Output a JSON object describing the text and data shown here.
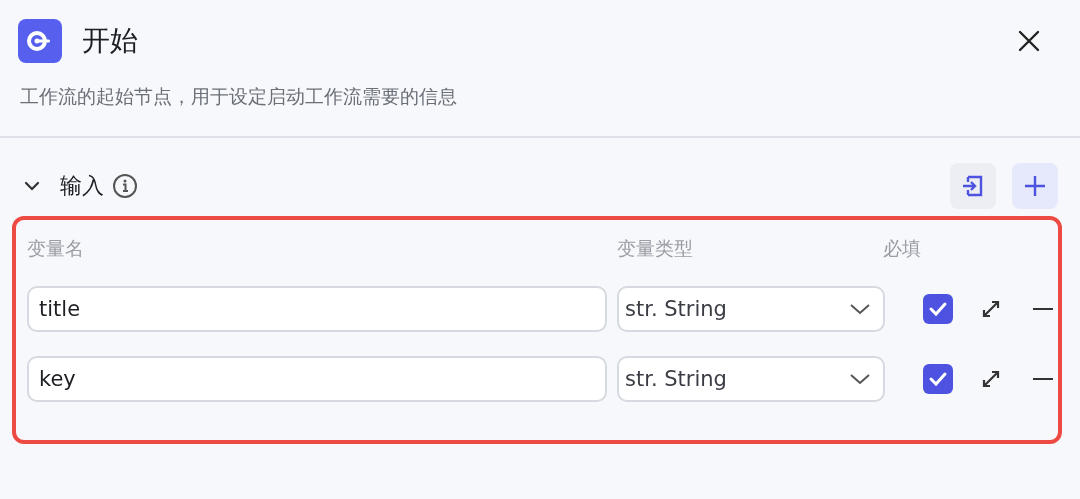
{
  "header": {
    "title": "开始",
    "description": "工作流的起始节点，用于设定启动工作流需要的信息"
  },
  "section": {
    "title": "输入",
    "expanded": true
  },
  "table": {
    "columns": [
      "变量名",
      "变量类型",
      "必填"
    ],
    "rows": [
      {
        "name": "title",
        "type": "str. String",
        "required": true
      },
      {
        "name": "key",
        "type": "str. String",
        "required": true
      }
    ]
  }
}
